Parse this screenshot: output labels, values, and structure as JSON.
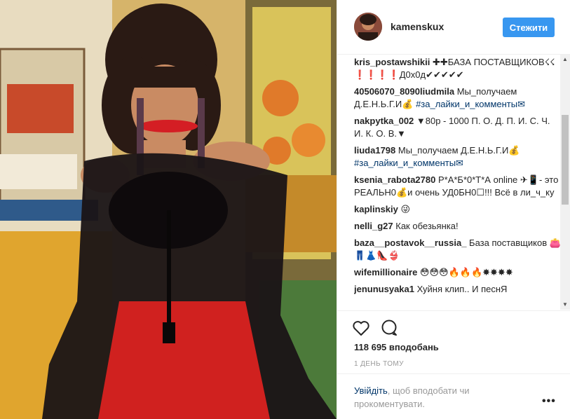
{
  "post": {
    "username": "kamenskux",
    "follow_label": "Стежити"
  },
  "comments": [
    {
      "user": "kris_postawshikii",
      "text": " ✚✚БАЗА ПОСТАВЩИКОВ☇☇ ❗❗❗❗Д0х0д✔✔✔✔✔",
      "tag": ""
    },
    {
      "user": "40506070_8090liudmila",
      "text": " Мы_получаем Д.Е.Н.Ь.Г.И💰 ",
      "tag": "#за_лайки_и_комменты✉"
    },
    {
      "user": "nakpytka_002",
      "text": " ▼80р - 1000 П. О. Д. П. И. С. Ч. И. К. О. В.▼",
      "tag": ""
    },
    {
      "user": "liuda1798",
      "text": " Мы_получаем Д.Е.Н.Ь.Г.И💰 ",
      "tag": "#за_лайки_и_комменты✉"
    },
    {
      "user": "ksenia_rabota2780",
      "text": " Р*А*Б*0*Т*А online ✈📱- это РЕАЛЬН0💰и очень УД0БН0☐!!! Всё в ли_ч_ку",
      "tag": ""
    },
    {
      "user": "kaplinskiy",
      "text": " 😜",
      "tag": ""
    },
    {
      "user": "nelli_g27",
      "text": " Как обезьянка!",
      "tag": ""
    },
    {
      "user": "baza__postavok__russia_",
      "text": " База поставщиков 👛👖👗👠👙",
      "tag": ""
    },
    {
      "user": "wifemillionaire",
      "text": " 😳😳😳🔥🔥🔥✸✸✸✸",
      "tag": ""
    },
    {
      "user": "jenunusyaka1",
      "text": " Хуйня клип.. И песнЯ",
      "tag": ""
    }
  ],
  "stats": {
    "likes": "118 695 вподобань",
    "time": "1 ДЕНЬ ТОМУ"
  },
  "footer": {
    "login_link": "Увійдіть",
    "login_rest": ", щоб вподобати чи прокоментувати.",
    "more_label": "•••"
  },
  "icons": {
    "like": "heart-icon",
    "comment": "speech-bubble-icon",
    "more": "ellipsis-icon"
  },
  "colors": {
    "accent": "#3897f0",
    "link": "#003569",
    "muted": "#999999"
  }
}
